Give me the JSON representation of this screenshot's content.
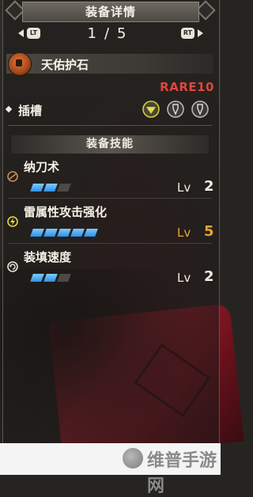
{
  "header": {
    "title": "装备详情"
  },
  "pager": {
    "left_button": "LT",
    "right_button": "RT",
    "current": "1",
    "separator": "/",
    "total": "5"
  },
  "item": {
    "name": "天佑护石",
    "rarity": "RARE10",
    "icon": "charm-icon"
  },
  "slots": {
    "label": "插槽",
    "gems": [
      {
        "icon": "slot-gem-level3-icon",
        "filled": true,
        "color": "#d8d342"
      },
      {
        "icon": "slot-gem-level2-icon",
        "filled": false,
        "color": "#bdbdbd"
      },
      {
        "icon": "slot-gem-level2-icon",
        "filled": false,
        "color": "#bdbdbd"
      }
    ]
  },
  "skills_section": {
    "title": "装备技能"
  },
  "skills": [
    {
      "name": "纳刀术",
      "icon": "sheathe-skill-icon",
      "icon_color": "#c98a55",
      "level_label": "Lv",
      "level": "2",
      "level_value": 2,
      "max_level": 3,
      "maxed": false
    },
    {
      "name": "雷属性攻击强化",
      "icon": "thunder-skill-icon",
      "icon_color": "#e6d53a",
      "level_label": "Lv",
      "level": "5",
      "level_value": 5,
      "max_level": 5,
      "maxed": true
    },
    {
      "name": "装填速度",
      "icon": "reload-skill-icon",
      "icon_color": "#e8e4da",
      "level_label": "Lv",
      "level": "2",
      "level_value": 2,
      "max_level": 3,
      "maxed": false
    }
  ],
  "watermark": {
    "text": "维普手游网",
    "icon": "site-logo-icon"
  },
  "colors": {
    "rarity": "#e0453f",
    "gauge_on": "#3fa0f0",
    "gauge_off": "#4d4a45",
    "max_level": "#e6a52e"
  }
}
